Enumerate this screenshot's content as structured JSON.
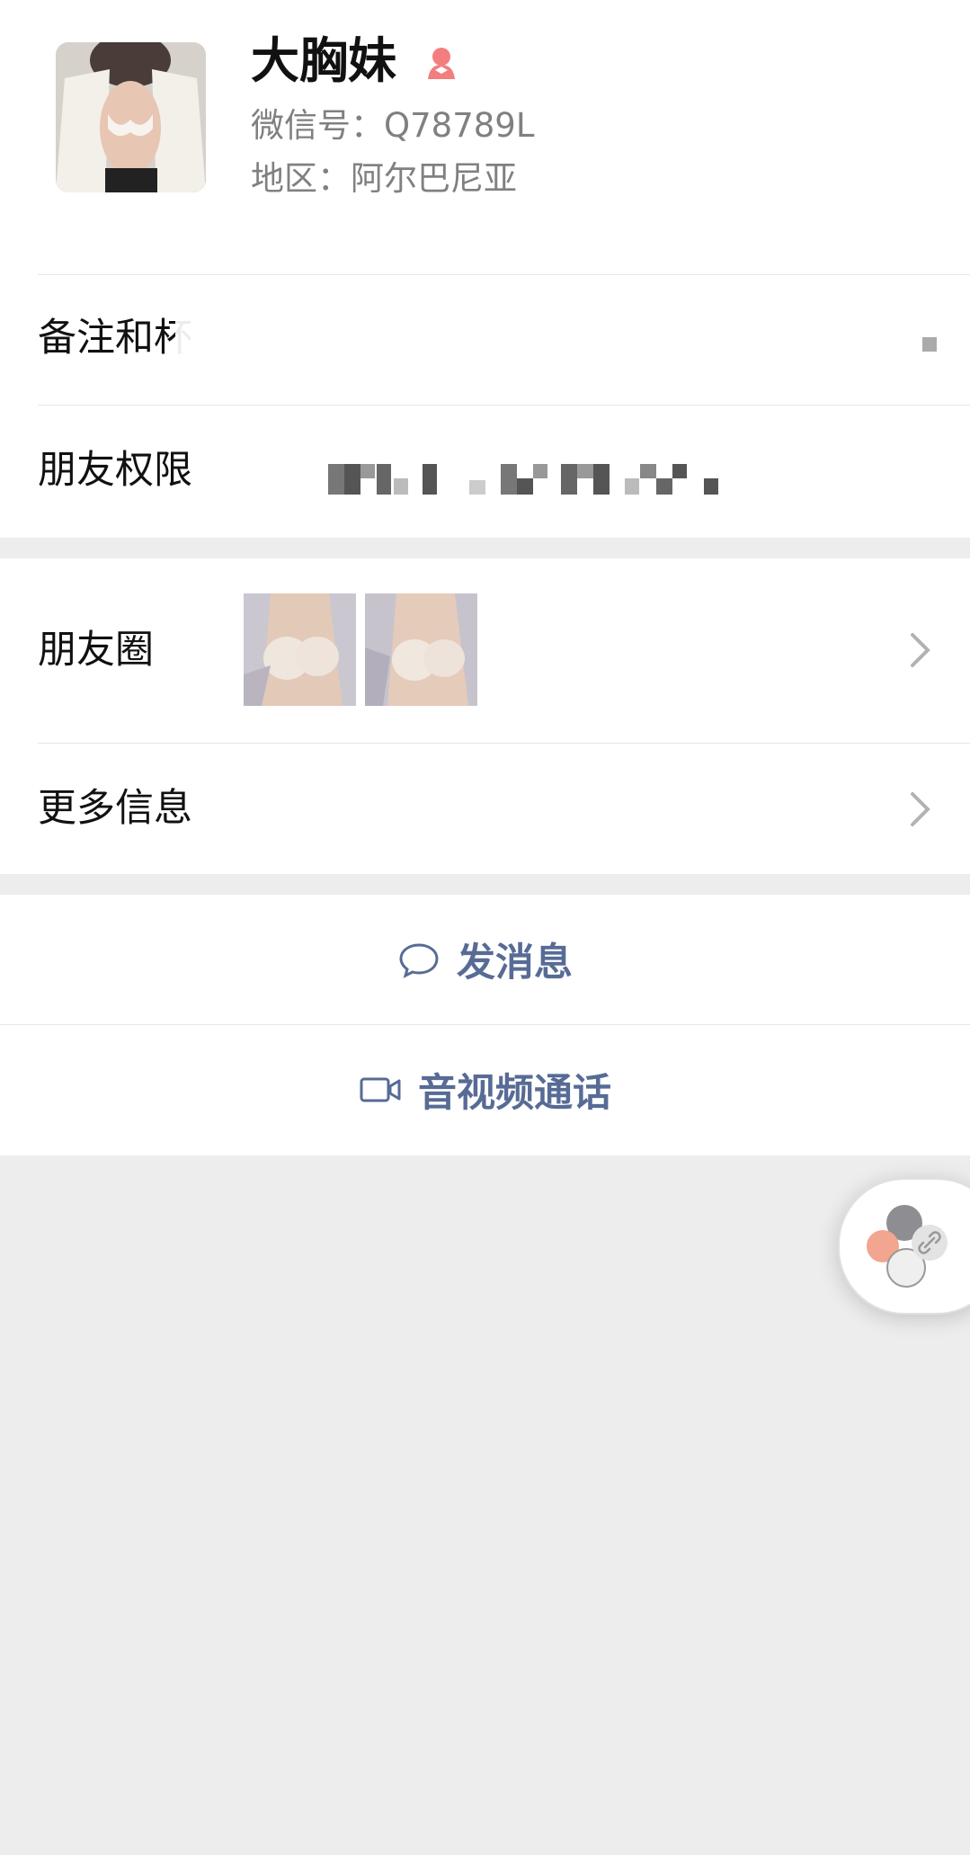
{
  "profile": {
    "name": "大胸妹",
    "wechat_id": "微信号：Q78789L",
    "region": "地区：阿尔巴尼亚",
    "gender_icon": "female-icon"
  },
  "rows": {
    "remarks_label": "备注和杯",
    "permissions_label": "朋友权限",
    "moments_label": "朋友圈",
    "more_info_label": "更多信息"
  },
  "actions": {
    "send_message": "发消息",
    "video_call": "音视频通话"
  },
  "colors": {
    "accent": "#576b95",
    "background": "#ededed",
    "gender_female": "#f37e7e"
  }
}
